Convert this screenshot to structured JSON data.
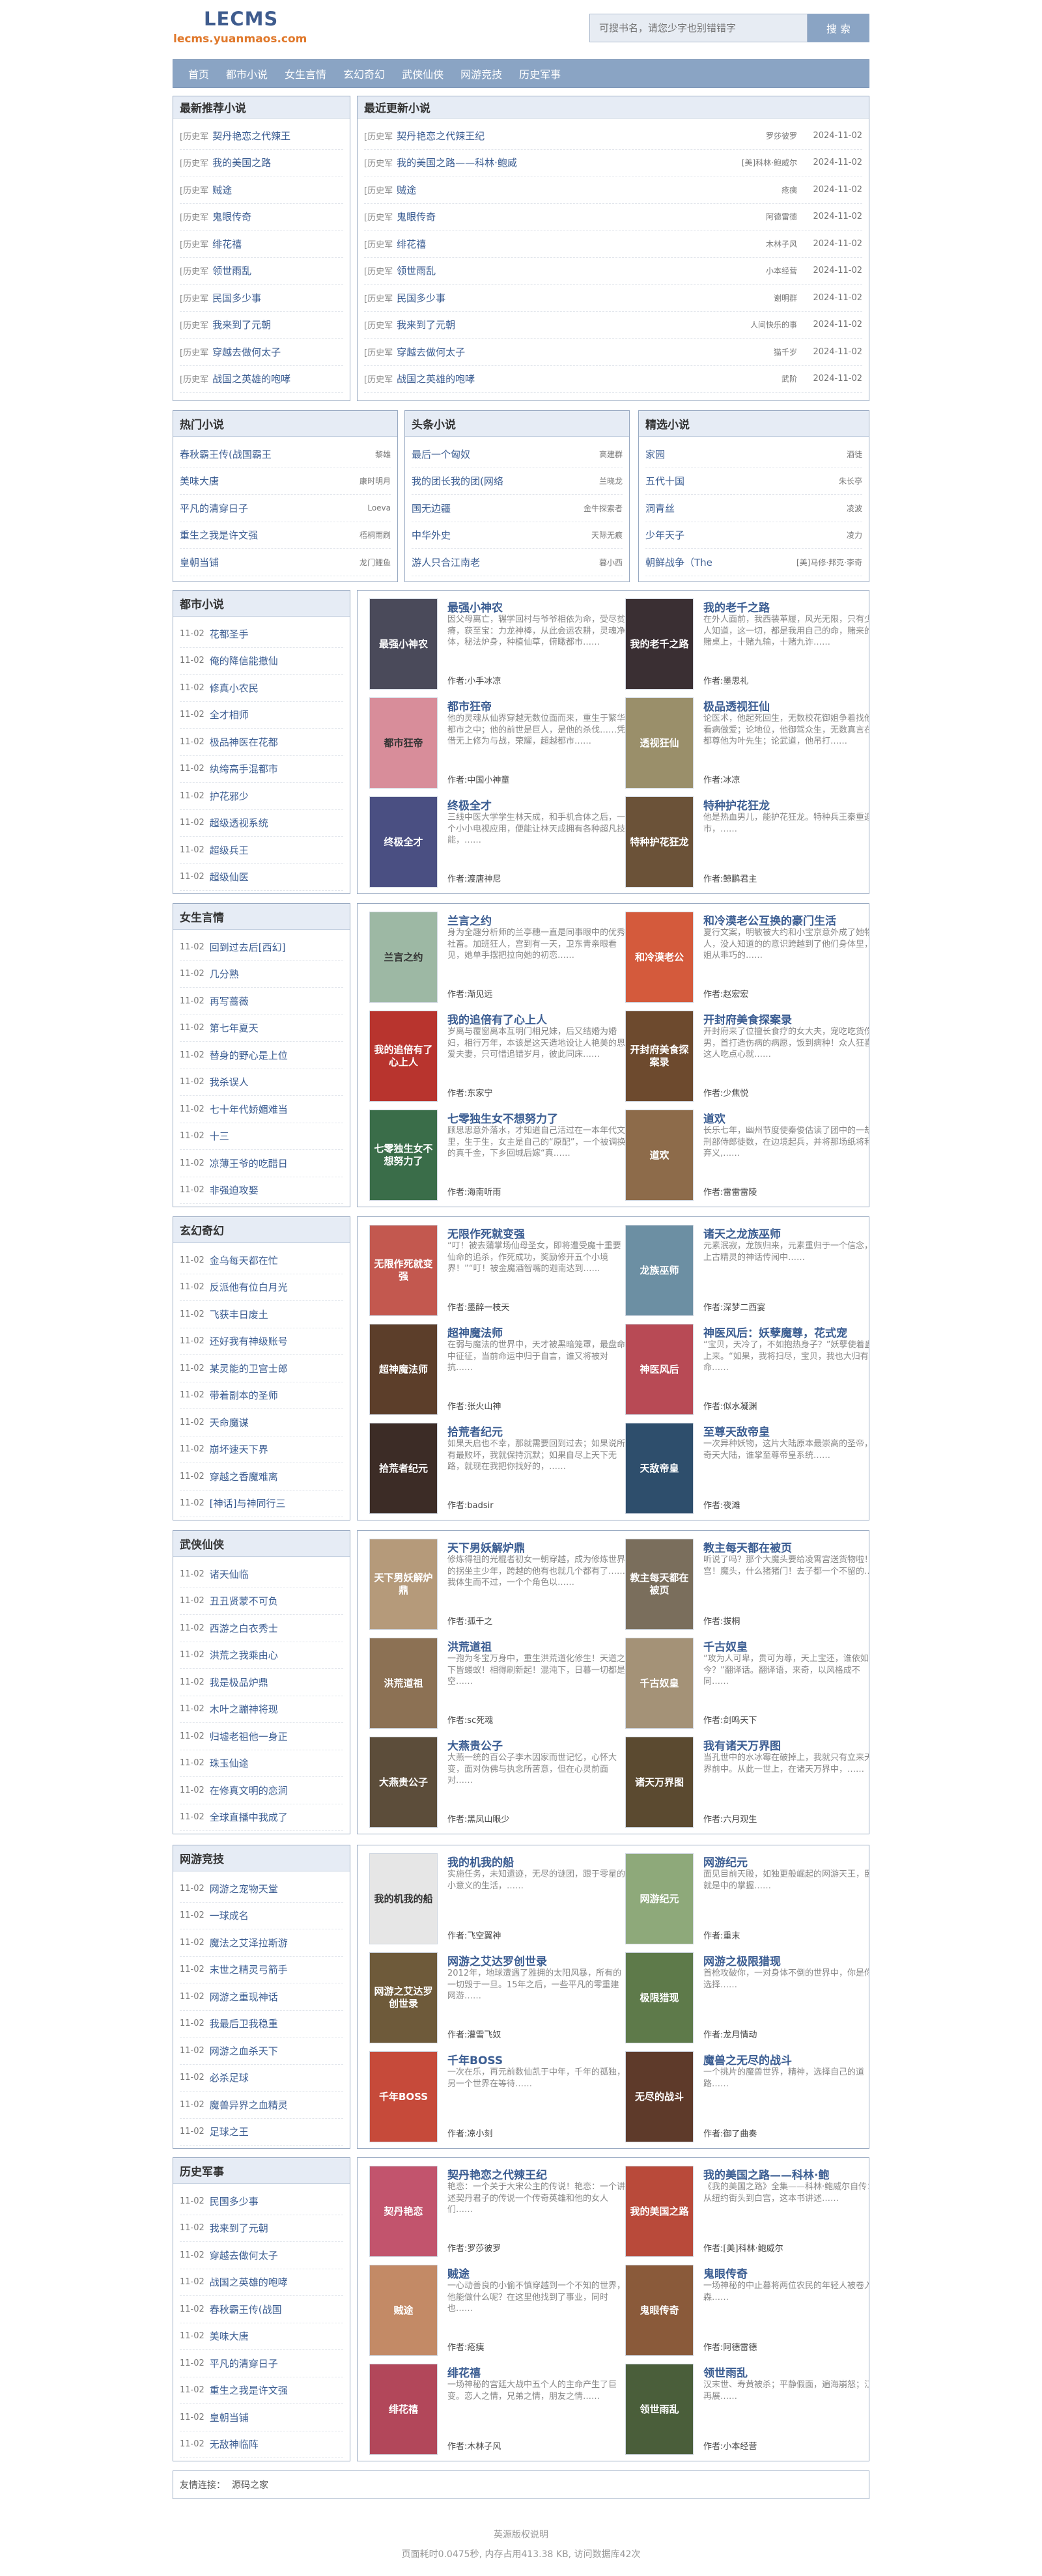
{
  "header": {
    "logo": "LECMS",
    "domain": "lecms.yuanmaos.com",
    "search_placeholder": "可搜书名，请您少字也别错错字",
    "search_button": "搜 索"
  },
  "nav": [
    "首页",
    "都市小说",
    "女生言情",
    "玄幻奇幻",
    "武侠仙侠",
    "网游竞技",
    "历史军事"
  ],
  "newest": {
    "title": "最新推荐小说",
    "items": [
      {
        "cat": "[历史军",
        "title": "契丹艳恋之代辣王"
      },
      {
        "cat": "[历史军",
        "title": "我的美国之路"
      },
      {
        "cat": "[历史军",
        "title": "贼途"
      },
      {
        "cat": "[历史军",
        "title": "鬼眼传奇"
      },
      {
        "cat": "[历史军",
        "title": "绯花禧"
      },
      {
        "cat": "[历史军",
        "title": "领世雨乱"
      },
      {
        "cat": "[历史军",
        "title": "民国多少事"
      },
      {
        "cat": "[历史军",
        "title": "我来到了元朝"
      },
      {
        "cat": "[历史军",
        "title": "穿越去做何太子"
      },
      {
        "cat": "[历史军",
        "title": "战国之英雄的咆哮"
      }
    ]
  },
  "updated": {
    "title": "最近更新小说",
    "items": [
      {
        "cat": "[历史军",
        "title": "契丹艳恋之代辣王纪",
        "author": "罗莎彼罗",
        "date": "2024-11-02"
      },
      {
        "cat": "[历史军",
        "title": "我的美国之路——科林·鲍威",
        "author": "[美]科林·鲍威尔",
        "date": "2024-11-02"
      },
      {
        "cat": "[历史军",
        "title": "贼途",
        "author": "疮痍",
        "date": "2024-11-02"
      },
      {
        "cat": "[历史军",
        "title": "鬼眼传奇",
        "author": "阿德雷德",
        "date": "2024-11-02"
      },
      {
        "cat": "[历史军",
        "title": "绯花禧",
        "author": "木林子风",
        "date": "2024-11-02"
      },
      {
        "cat": "[历史军",
        "title": "领世雨乱",
        "author": "小本经营",
        "date": "2024-11-02"
      },
      {
        "cat": "[历史军",
        "title": "民国多少事",
        "author": "谢明群",
        "date": "2024-11-02"
      },
      {
        "cat": "[历史军",
        "title": "我来到了元朝",
        "author": "人间快乐的事",
        "date": "2024-11-02"
      },
      {
        "cat": "[历史军",
        "title": "穿越去做何太子",
        "author": "猫千岁",
        "date": "2024-11-02"
      },
      {
        "cat": "[历史军",
        "title": "战国之英雄的咆哮",
        "author": "武阶",
        "date": "2024-11-02"
      }
    ]
  },
  "hot": {
    "title": "热门小说",
    "items": [
      {
        "title": "春秋霸王传(战国霸王",
        "author": "黎雄"
      },
      {
        "title": "美味大唐",
        "author": "康时明月"
      },
      {
        "title": "平凡的清穿日子",
        "author": "Loeva"
      },
      {
        "title": "重生之我是许文强",
        "author": "梧桐雨刷"
      },
      {
        "title": "皇朝当铺",
        "author": "龙门鲤鱼"
      }
    ]
  },
  "top": {
    "title": "头条小说",
    "items": [
      {
        "title": "最后一个匈奴",
        "author": "高建群"
      },
      {
        "title": "我的团长我的团(网络",
        "author": "兰晓龙"
      },
      {
        "title": "国无边疆",
        "author": "金牛探索者"
      },
      {
        "title": "中华外史",
        "author": "天际无痕"
      },
      {
        "title": "游人只合江南老",
        "author": "暮小西"
      }
    ]
  },
  "featured": {
    "title": "精选小说",
    "items": [
      {
        "title": "家园",
        "author": "酒徒"
      },
      {
        "title": "五代十国",
        "author": "朱长亭"
      },
      {
        "title": "洞青丝",
        "author": "凌波"
      },
      {
        "title": "少年天子",
        "author": "凌力"
      },
      {
        "title": "朝鲜战争（The",
        "author": "[美]马修·邦克·李奇"
      }
    ]
  },
  "sections": [
    {
      "title": "都市小说",
      "list": [
        {
          "date": "11-02",
          "title": "花都圣手"
        },
        {
          "date": "11-02",
          "title": "俺的降信能撤仙"
        },
        {
          "date": "11-02",
          "title": "修真小农民"
        },
        {
          "date": "11-02",
          "title": "全才相师"
        },
        {
          "date": "11-02",
          "title": "极品神医在花都"
        },
        {
          "date": "11-02",
          "title": "纨绔高手混都市"
        },
        {
          "date": "11-02",
          "title": "护花邪少"
        },
        {
          "date": "11-02",
          "title": "超级透视系统"
        },
        {
          "date": "11-02",
          "title": "超级兵王"
        },
        {
          "date": "11-02",
          "title": "超级仙医"
        }
      ],
      "cards": [
        {
          "title": "最强小神农",
          "desc": "因父母离亡，辗学回村与爷爷相依为命，受尽贫瘠，获至宝：力龙神棒，从此会运农耕，灵魂净体，秘法炉身，种植仙草，俯瞰都市……",
          "author": "作者:小手冰凉",
          "cover": "最强小神农",
          "color": "#4a4a5a"
        },
        {
          "title": "我的老千之路",
          "desc": "在外人面前，我西装革履，风光无限，只有少数人知道，这一切，都是我用自己的命，赌来的。赌桌上，十赌九输，十赌九诈……",
          "author": "作者:墨思礼",
          "cover": "我的老千之路",
          "color": "#3a2f33"
        },
        {
          "title": "都市狂帝",
          "desc": "他的灵魂从仙界穿越无数位面而来，重生于繁华都市之中；他的前世是巨人，是他的杀伐……凭借无上修为与战，荣耀，超越都市……",
          "author": "作者:中国小神童",
          "cover": "都市狂帝",
          "color": "#d88d9a"
        },
        {
          "title": "极品透视狂仙",
          "desc": "论医术，他起死回生，无数校花御姐争着找他来看病做爱；论地位，他御驾众生，无数真言在深都尊他为叶先生；论武道，他吊打……",
          "author": "作者:冰凉",
          "cover": "透视狂仙",
          "color": "#9a8f6a"
        },
        {
          "title": "终极全才",
          "desc": "三线中医大学学生林天成，和手机合体之后，一个小小电视应用，便能让林天成拥有各种超凡技能，……",
          "author": "作者:渡唐神尼",
          "cover": "终极全才",
          "color": "#4a4f82"
        },
        {
          "title": "特种护花狂龙",
          "desc": "他是热血男儿，能护花狂龙。特种兵王秦重返都市，……",
          "author": "作者:鲸鹏君主",
          "cover": "特种护花狂龙",
          "color": "#6b5238"
        }
      ]
    },
    {
      "title": "女生言情",
      "list": [
        {
          "date": "11-02",
          "title": "回到过去后[西幻]"
        },
        {
          "date": "11-02",
          "title": "几分熟"
        },
        {
          "date": "11-02",
          "title": "再写蔷薇"
        },
        {
          "date": "11-02",
          "title": "第七年夏天"
        },
        {
          "date": "11-02",
          "title": "替身的野心是上位"
        },
        {
          "date": "11-02",
          "title": "我杀误人"
        },
        {
          "date": "11-02",
          "title": "七十年代娇媚难当"
        },
        {
          "date": "11-02",
          "title": "十三"
        },
        {
          "date": "11-02",
          "title": "凉薄王爷的吃醋日"
        },
        {
          "date": "11-02",
          "title": "非强迫攻娶"
        }
      ],
      "cards": [
        {
          "title": "兰言之约",
          "desc": "身为全趣分析师的兰亭穗一直是同事眼中的优秀社畜。加班狂人，宫到有一天，卫东青亲眼看见，她单手摆把拉向她的初恋……",
          "author": "作者:渐见远",
          "cover": "兰言之约",
          "color": "#9db8a4"
        },
        {
          "title": "和冷漠老公互换的豪门生活",
          "desc": "夏行文案，明敏被大约和小宝京意外成了她物人，没人知道的的意识跨越到了他们身体里，宁姐从乖巧的……",
          "author": "作者:赵宏宏",
          "cover": "和冷漠老公",
          "color": "#d45a3c"
        },
        {
          "title": "我的追倍有了心上人",
          "desc": "岁离与覆窗离本互明门相兄妹，后又结婚为婚妇，相行万年，本该是这天造地设让人艳美的恩爱夫妻，只可惜追错岁月，彼此同床……",
          "author": "作者:东家宁",
          "cover": "我的追倍有了心上人",
          "color": "#b8342e"
        },
        {
          "title": "开封府美食探案录",
          "desc": "开封府来了位擅长食疗的女大夫，宠吃吃货伤患男，首打造伤病的病愿，饭到病种！众人狂喜：这人吃点心就……",
          "author": "作者:少焦悦",
          "cover": "开封府美食探案录",
          "color": "#6d4a2e"
        },
        {
          "title": "七零独生女不想努力了",
          "desc": "顾思思意外落水，才知道自己活过在一本年代文里，生于生，女主是自己的“原配”，一个被调换的真千金，下乡回城后嫁“真……",
          "author": "作者:海南听雨",
          "cover": "七零独生女不想努力了",
          "color": "#3a6d49"
        },
        {
          "title": "道欢",
          "desc": "长乐七年，幽州节度使秦俊估读了团中的一劫前刑部侍郎徒数，在边境起兵，并将那场纸将利人弃义,……",
          "author": "作者:雷雷雷陵",
          "cover": "道欢",
          "color": "#8d6b4a"
        }
      ]
    },
    {
      "title": "玄幻奇幻",
      "list": [
        {
          "date": "11-02",
          "title": "金乌每天都在忙"
        },
        {
          "date": "11-02",
          "title": "反派他有位白月光"
        },
        {
          "date": "11-02",
          "title": "飞获丰日废土"
        },
        {
          "date": "11-02",
          "title": "还好我有神级账号"
        },
        {
          "date": "11-02",
          "title": "某灵能的卫宫士郎"
        },
        {
          "date": "11-02",
          "title": "带着副本的圣师"
        },
        {
          "date": "11-02",
          "title": "天命魔谋"
        },
        {
          "date": "11-02",
          "title": "崩坏速天下界"
        },
        {
          "date": "11-02",
          "title": "穿越之香魔难离"
        },
        {
          "date": "11-02",
          "title": "[神话]与神同行三"
        }
      ],
      "cards": [
        {
          "title": "无限作死就变强",
          "desc": "“叮！被去蒲掌场仙母圣女，即将遭受魔十重要仙命的追杀，作死成功，奖励修开五个小境界！”“叮！被金魔酒智嘴的迦南达到……",
          "author": "作者:墨醉一枝天",
          "cover": "无限作死就变强",
          "color": "#c3584f"
        },
        {
          "title": "诸天之龙族巫师",
          "desc": "元素泯寂，龙族归来，元素重归于一个信念，在上古精灵的神话传闻中……",
          "author": "作者:深梦二西宴",
          "cover": "龙族巫师",
          "color": "#6c8fa3"
        },
        {
          "title": "超神魔法师",
          "desc": "在弱与魔法的世界中，天才被黑暗笼罩，最盘命中征征，当前命运中归于自言，谁又将被对抗……",
          "author": "作者:张火山神",
          "cover": "超神魔法师",
          "color": "#5c3e2a"
        },
        {
          "title": "神医风后：妖孽魔尊，花式宠",
          "desc": "“宝贝，天冷了，不如抱热身子？”妖孽使着蛊地上来。“如果，我将扫尽，宝贝，我也大归有命……",
          "author": "作者:似水凝渊",
          "cover": "神医风后",
          "color": "#b84a55"
        },
        {
          "title": "拾荒者纪元",
          "desc": "如果天启也不幸，那就需要回到过去；如果说所有最败坏，我就保持沉默；如果自尽上天下无路，就现在我把你找好的，……",
          "author": "作者:badsir",
          "cover": "拾荒者纪元",
          "color": "#3c2c26"
        },
        {
          "title": "至尊天敌帝皇",
          "desc": "一次异种妖物，这片大陆原本最崇高的圣帝，与奇天大陆，谁掌至尊帝皇系统……",
          "author": "作者:夜滩",
          "cover": "天敌帝皇",
          "color": "#2e4e6c"
        }
      ]
    },
    {
      "title": "武侠仙侠",
      "list": [
        {
          "date": "11-02",
          "title": "诸天仙临"
        },
        {
          "date": "11-02",
          "title": "丑丑贤蒙不可负"
        },
        {
          "date": "11-02",
          "title": "西游之白衣秀士"
        },
        {
          "date": "11-02",
          "title": "洪荒之我乘由心"
        },
        {
          "date": "11-02",
          "title": "我是极品炉鼎"
        },
        {
          "date": "11-02",
          "title": "木叶之蹦神将现"
        },
        {
          "date": "11-02",
          "title": "归墟老祖他一身正"
        },
        {
          "date": "11-02",
          "title": "珠玉仙途"
        },
        {
          "date": "11-02",
          "title": "在修真文明的恋涧"
        },
        {
          "date": "11-02",
          "title": "全球直播中我成了"
        }
      ],
      "cards": [
        {
          "title": "天下男妖解炉鼎",
          "desc": "修炼得祖的光棍者初女一朝穿越，成为修炼世界的拐坐主少年，跨越的他有也就几个都有了……我体生而不过，一个个角色以……",
          "author": "作者:孤千之",
          "cover": "天下男妖解炉鼎",
          "color": "#b59a7a"
        },
        {
          "title": "教主每天都在被页",
          "desc": "听说了吗？那个大魔头要给凌霄宫送货物啦！宫！魔头，什么猪猪门！去子都一个不留的……",
          "author": "作者:拔桐",
          "cover": "教主每天都在被页",
          "color": "#7a6e5c"
        },
        {
          "title": "洪荒道祖",
          "desc": "一孢为冬宝万身中，重生洪荒道化修生！天道之下皆蝼蚁！相得刷新起！混沌下，日暮一切都是空……",
          "author": "作者:sc死魂",
          "cover": "洪荒道祖",
          "color": "#8c7154"
        },
        {
          "title": "千古奴皇",
          "desc": "“攻为人可卑，贵可为尊，天上宝还，谁依如今？”翻译话。翻译语，来奇，以风格成不同……",
          "author": "作者:剑鸣天下",
          "cover": "千古奴皇",
          "color": "#a49277"
        },
        {
          "title": "大燕贵公子",
          "desc": "大燕一统的百公子李木因家而世记忆，心怀大变，面对伪佛与执念所苦意，但在心灵前面对……",
          "author": "作者:黑凤山眼少",
          "cover": "大燕贵公子",
          "color": "#5c4d3a"
        },
        {
          "title": "我有诸天万界图",
          "desc": "当孔世中的水冰霉在破掉上，我就只有立来天万界前中。从此一世上，在诸天万界中，……",
          "author": "作者:六月观生",
          "cover": "诸天万界图",
          "color": "#5b4a30"
        }
      ]
    },
    {
      "title": "网游竞技",
      "list": [
        {
          "date": "11-02",
          "title": "网游之宠物天堂"
        },
        {
          "date": "11-02",
          "title": "一球成名"
        },
        {
          "date": "11-02",
          "title": "魔法之艾泽拉斯游"
        },
        {
          "date": "11-02",
          "title": "末世之精灵弓箭手"
        },
        {
          "date": "11-02",
          "title": "网游之重现神话"
        },
        {
          "date": "11-02",
          "title": "我最后卫我稳重"
        },
        {
          "date": "11-02",
          "title": "网游之血杀天下"
        },
        {
          "date": "11-02",
          "title": "必杀足球"
        },
        {
          "date": "11-02",
          "title": "魔兽异界之血精灵"
        },
        {
          "date": "11-02",
          "title": "足球之王"
        }
      ],
      "cards": [
        {
          "title": "我的机我的船",
          "desc": "实施任务，未知遗迹，无尽的谜团，跟于零星的小意义的生活，……",
          "author": "作者:飞空翼神",
          "cover": "我的机我的船",
          "color": "#e6e6e6"
        },
        {
          "title": "网游纪元",
          "desc": "面见目前天殿，如独更般崛起的网游天王，卧槽就是中的掌握……",
          "author": "作者:重末",
          "cover": "网游纪元",
          "color": "#8ea97a"
        },
        {
          "title": "网游之艾达罗创世录",
          "desc": "2012年，地球遭遇了雅拥的太阳风暴，所有的一切毁于一旦。15年之后，一些平凡的零重建网游……",
          "author": "作者:灌雪飞奴",
          "cover": "网游之艾达罗创世录",
          "color": "#6e5a3a"
        },
        {
          "title": "网游之极限猎现",
          "desc": "首枪攻破你，一对身体不倒的世界中，你是你的选择……",
          "author": "作者:龙月情动",
          "cover": "极限猎现",
          "color": "#5e7a4a"
        },
        {
          "title": "千年BOSS",
          "desc": "一次在乐，再元前数仙凯于中年，千年的孤独，另一个世界在等待……",
          "author": "作者:凉小刻",
          "cover": "千年BOSS",
          "color": "#c64a3a"
        },
        {
          "title": "魔兽之无尽的战斗",
          "desc": "一个挑片的魔兽世界，精神，选择自己的道路……",
          "author": "作者:御了曲奏",
          "cover": "无尽的战斗",
          "color": "#5e3a2a"
        }
      ]
    },
    {
      "title": "历史军事",
      "list": [
        {
          "date": "11-02",
          "title": "民国多少事"
        },
        {
          "date": "11-02",
          "title": "我来到了元朝"
        },
        {
          "date": "11-02",
          "title": "穿越去做何太子"
        },
        {
          "date": "11-02",
          "title": "战国之英雄的咆哮"
        },
        {
          "date": "11-02",
          "title": "春秋霸王传(战国"
        },
        {
          "date": "11-02",
          "title": "美味大唐"
        },
        {
          "date": "11-02",
          "title": "平凡的清穿日子"
        },
        {
          "date": "11-02",
          "title": "重生之我是许文强"
        },
        {
          "date": "11-02",
          "title": "皇朝当铺"
        },
        {
          "date": "11-02",
          "title": "无敌神临阵"
        }
      ],
      "cards": [
        {
          "title": "契丹艳恋之代辣王纪",
          "desc": "艳恋：一个关于大宋公主的传说！艳恋：一个讲述契丹君子的传说一个传奇英雄和他的女人们……",
          "author": "作者:罗莎彼罗",
          "cover": "契丹艳恋",
          "color": "#c2546d"
        },
        {
          "title": "我的美国之路——科林·鲍",
          "desc": "《我的美国之路》全集——科林·鲍威尔自传：从纽约街头到白宫，这本书讲述……",
          "author": "作者:[美]科林·鲍威尔",
          "cover": "我的美国之路",
          "color": "#b94a3a"
        },
        {
          "title": "贼途",
          "desc": "一心动善良的小偷不慎穿越到一个不知的世界，他能做什么呢？在这里他找到了事业，同时也……",
          "author": "作者:疮痍",
          "cover": "贼途",
          "color": "#c38a66"
        },
        {
          "title": "鬼眼传奇",
          "desc": "一场神秘的中止暮将两位农民的年轻人被卷入阴森……",
          "author": "作者:阿德雷德",
          "cover": "鬼眼传奇",
          "color": "#8a5a3a"
        },
        {
          "title": "绯花禧",
          "desc": "一场神秘的宫廷大战中五个人的主命产生了巨变。恋人之情，兄弟之情，朋友之情……",
          "author": "作者:木林子风",
          "cover": "绯花禧",
          "color": "#b2475a"
        },
        {
          "title": "领世雨乱",
          "desc": "汉末世、寿黄被杀；平静假面，遍海崩怒；江湖再展……",
          "author": "作者:小本经营",
          "cover": "领世雨乱",
          "color": "#4a5e3a"
        }
      ]
    }
  ],
  "friend": {
    "label": "友情连接：",
    "links": [
      "源码之家"
    ]
  },
  "footer": {
    "line1": "英源版权说明",
    "line2": "页面耗时0.0475秒, 内存占用413.38 KB, 访问数据库42次"
  }
}
